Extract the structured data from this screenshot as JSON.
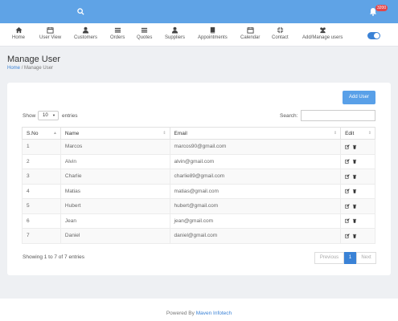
{
  "header": {
    "notification_count": "3200",
    "colors": {
      "topbar": "#5fa3e6",
      "accent": "#3a82d6",
      "badge": "#e2474b"
    }
  },
  "nav": [
    {
      "label": "Home",
      "icon": "home-icon"
    },
    {
      "label": "User View",
      "icon": "calendar-icon"
    },
    {
      "label": "Customers",
      "icon": "user-icon"
    },
    {
      "label": "Orders",
      "icon": "list-icon"
    },
    {
      "label": "Quotes",
      "icon": "list-icon"
    },
    {
      "label": "Suppliers",
      "icon": "user-icon"
    },
    {
      "label": "Appointments",
      "icon": "book-icon"
    },
    {
      "label": "Calendar",
      "icon": "calendar-icon"
    },
    {
      "label": "Contact",
      "icon": "compress-icon"
    },
    {
      "label": "Add/Manage users",
      "icon": "users-icon"
    }
  ],
  "page": {
    "title": "Manage User",
    "breadcrumb_home": "Home",
    "breadcrumb_sep": "/",
    "breadcrumb_current": "Manage User"
  },
  "controls": {
    "add_button": "Add User",
    "show_label": "Show",
    "show_value": "10",
    "entries_label": "entries",
    "search_label": "Search:",
    "search_value": ""
  },
  "table": {
    "columns": [
      "S.No",
      "Name",
      "Email",
      "Edit"
    ],
    "rows": [
      {
        "sno": "1",
        "name": "Marcos",
        "email": "marcos90@gmail.com"
      },
      {
        "sno": "2",
        "name": "Alvin",
        "email": "alvin@gmail.com"
      },
      {
        "sno": "3",
        "name": "Charlie",
        "email": "charlie89@gmail.com"
      },
      {
        "sno": "4",
        "name": "Matias",
        "email": "matias@gmail.com"
      },
      {
        "sno": "5",
        "name": "Hubert",
        "email": "hubert@gmail.com"
      },
      {
        "sno": "6",
        "name": "Jean",
        "email": "jean@gmail.com"
      },
      {
        "sno": "7",
        "name": "Daniel",
        "email": "daniel@gmail.com"
      }
    ]
  },
  "pagination": {
    "info": "Showing 1 to 7 of 7 entries",
    "previous": "Previous",
    "current": "1",
    "next": "Next"
  },
  "footer": {
    "prefix": "Powered By ",
    "brand": "Maven Infotech"
  }
}
